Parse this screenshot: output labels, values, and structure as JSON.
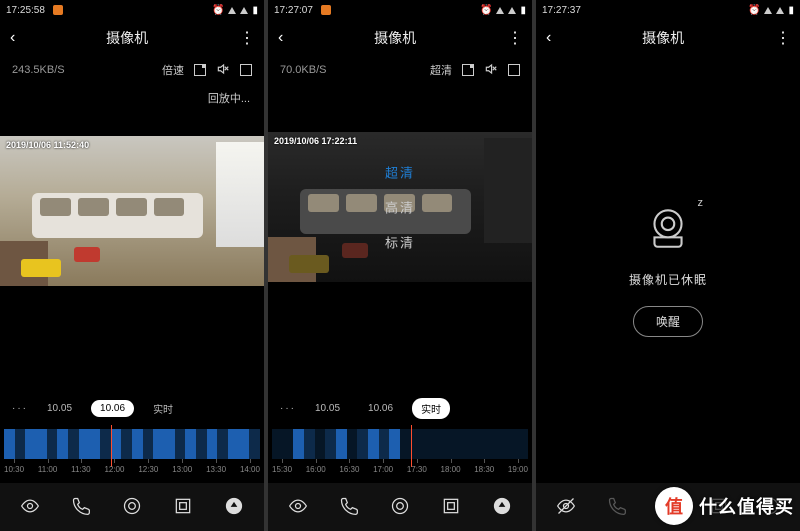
{
  "panel1": {
    "status_time": "17:25:58",
    "title": "摄像机",
    "kbps": "243.5KB/S",
    "speed_label": "倍速",
    "loading_text": "回放中...",
    "video_ts": "2019/10/06  11:52:40",
    "dates": {
      "dots": "···",
      "d1": "10.05",
      "d2": "10.06",
      "live": "实时"
    },
    "ticks": [
      "10:30",
      "11:00",
      "11:30",
      "12:00",
      "12:30",
      "13:00",
      "13:30",
      "14:00"
    ],
    "playhead_pos": "42%"
  },
  "panel2": {
    "status_time": "17:27:07",
    "title": "摄像机",
    "kbps": "70.0KB/S",
    "quality_label": "超清",
    "video_ts": "2019/10/06  17:22:11",
    "quality": {
      "uhd": "超清",
      "hd": "高清",
      "sd": "标清"
    },
    "dates": {
      "dots": "···",
      "d1": "10.05",
      "d2": "10.06",
      "live": "实时"
    },
    "ticks": [
      "15:30",
      "16:00",
      "16:30",
      "17:00",
      "17:30",
      "18:00",
      "18:30",
      "19:00"
    ],
    "playhead_pos": "54%"
  },
  "panel3": {
    "status_time": "17:27:37",
    "title": "摄像机",
    "sleep_msg": "摄像机已休眠",
    "wake_label": "唤醒"
  },
  "watermark": {
    "char": "值",
    "text": "什么值得买"
  }
}
